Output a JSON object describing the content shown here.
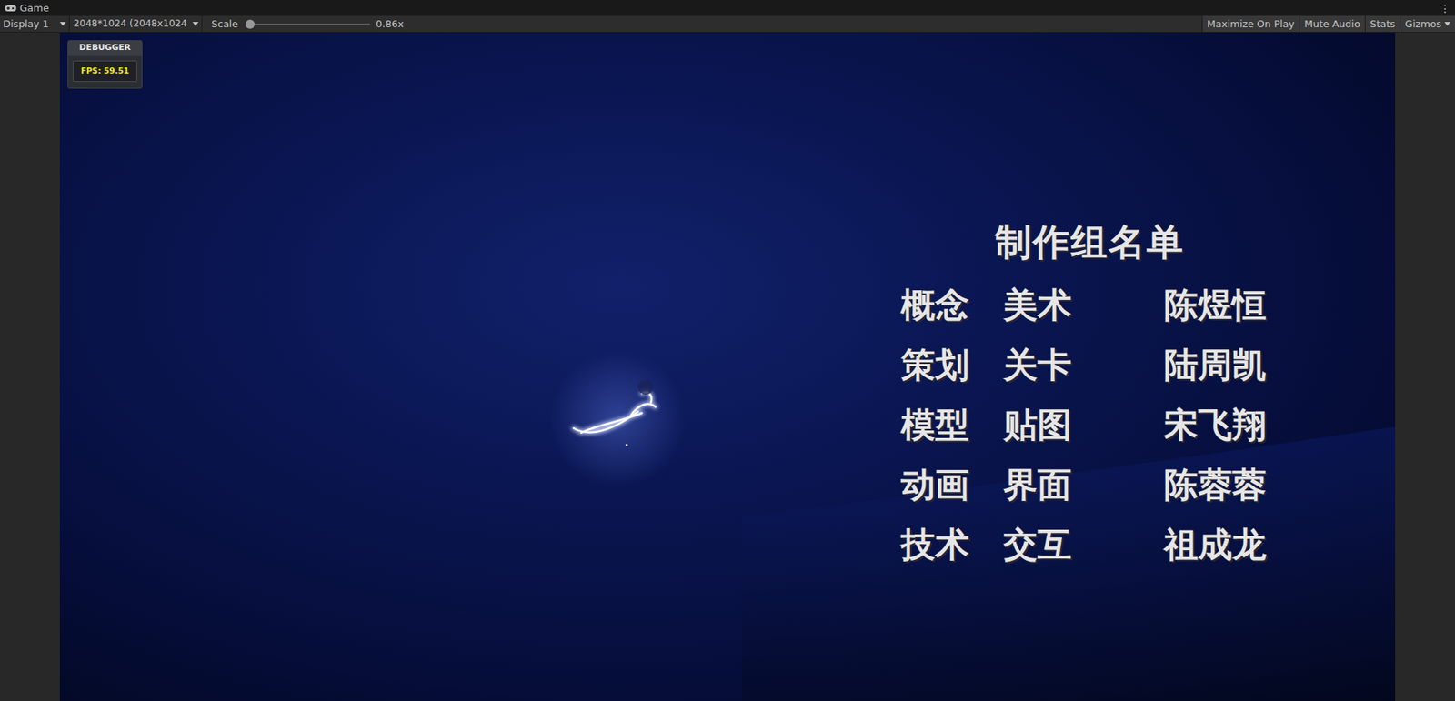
{
  "window": {
    "title": "Game",
    "menu": "⋮"
  },
  "toolbar": {
    "display": "Display 1",
    "resolution": "2048*1024 (2048x1024",
    "scale_label": "Scale",
    "scale_level": 0.0,
    "scale_value": "0.86x",
    "buttons": [
      "Maximize On Play",
      "Mute Audio",
      "Stats",
      "Gizmos"
    ]
  },
  "debugger": {
    "title": "DEBUGGER",
    "fps": "FPS: 59.51"
  },
  "credits": {
    "title": "制作组名单",
    "rows": [
      {
        "role1": "概念",
        "role2": "美术",
        "name": "陈煜恒"
      },
      {
        "role1": "策划",
        "role2": "关卡",
        "name": "陆周凯"
      },
      {
        "role1": "模型",
        "role2": "贴图",
        "name": "宋飞翔"
      },
      {
        "role1": "动画",
        "role2": "界面",
        "name": "陈蓉蓉"
      },
      {
        "role1": "技术",
        "role2": "交互",
        "name": "祖成龙"
      }
    ]
  }
}
